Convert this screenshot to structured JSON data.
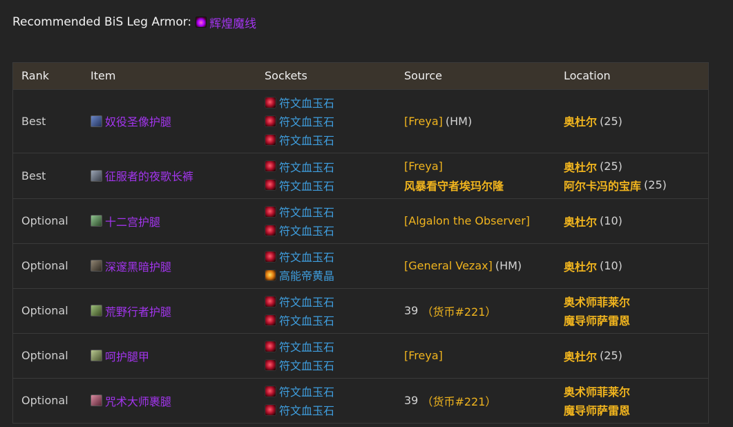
{
  "heading": {
    "label": "Recommended BiS Leg Armor:",
    "enchant_name": "辉煌魔线",
    "enchant_icon": "enchant-icon",
    "enchant_color": "#a335ee"
  },
  "table": {
    "columns": [
      "Rank",
      "Item",
      "Sockets",
      "Source",
      "Location"
    ],
    "rows": [
      {
        "rank": "Best",
        "item": "奴役圣像护腿",
        "sockets": [
          "符文血玉石",
          "符文血玉石",
          "符文血玉石"
        ],
        "source": [
          {
            "name": "[Freya]",
            "suffix": " (HM)"
          }
        ],
        "location": [
          {
            "name": "奥杜尔",
            "suffix": " (25)"
          }
        ]
      },
      {
        "rank": "Best",
        "item": "征服者的夜歌长裤",
        "sockets": [
          "符文血玉石",
          "符文血玉石"
        ],
        "source": [
          {
            "name": "[Freya]",
            "suffix": ""
          },
          {
            "name": "风暴看守者埃玛尔隆",
            "suffix": ""
          }
        ],
        "location": [
          {
            "name": "奥杜尔",
            "suffix": " (25)"
          },
          {
            "name": "阿尔卡冯的宝库",
            "suffix": " (25)"
          }
        ]
      },
      {
        "rank": "Optional",
        "item": "十二宫护腿",
        "sockets": [
          "符文血玉石",
          "符文血玉石"
        ],
        "source": [
          {
            "name": "[Algalon the Observer]",
            "suffix": ""
          }
        ],
        "location": [
          {
            "name": "奥杜尔",
            "suffix": " (10)"
          }
        ]
      },
      {
        "rank": "Optional",
        "item": "深邃黑暗护腿",
        "sockets": [
          "符文血玉石",
          "高能帝黄晶"
        ],
        "source": [
          {
            "name": "[General Vezax]",
            "suffix": " (HM)"
          }
        ],
        "location": [
          {
            "name": "奥杜尔",
            "suffix": " (10)"
          }
        ]
      },
      {
        "rank": "Optional",
        "item": "荒野行者护腿",
        "sockets": [
          "符文血玉石",
          "符文血玉石"
        ],
        "source": [
          {
            "cost": "39",
            "currency": "货币#221"
          }
        ],
        "location": [
          {
            "name": "奥术师菲莱尔",
            "suffix": ""
          },
          {
            "name": "魔导师萨雷恩",
            "suffix": ""
          }
        ]
      },
      {
        "rank": "Optional",
        "item": "呵护腿甲",
        "sockets": [
          "符文血玉石",
          "符文血玉石"
        ],
        "source": [
          {
            "name": "[Freya]",
            "suffix": ""
          }
        ],
        "location": [
          {
            "name": "奥杜尔",
            "suffix": " (25)"
          }
        ]
      },
      {
        "rank": "Optional",
        "item": "咒术大师裹腿",
        "sockets": [
          "符文血玉石",
          "符文血玉石"
        ],
        "source": [
          {
            "cost": "39",
            "currency": "货币#221"
          }
        ],
        "location": [
          {
            "name": "奥术师菲莱尔",
            "suffix": ""
          },
          {
            "name": "魔导师萨雷恩",
            "suffix": ""
          }
        ]
      }
    ]
  },
  "colors": {
    "epic": "#a335ee",
    "gem_link": "#3f9fe0",
    "npc": "#f0b41e",
    "header_bg": "#3a342c",
    "page_bg": "#242424"
  }
}
